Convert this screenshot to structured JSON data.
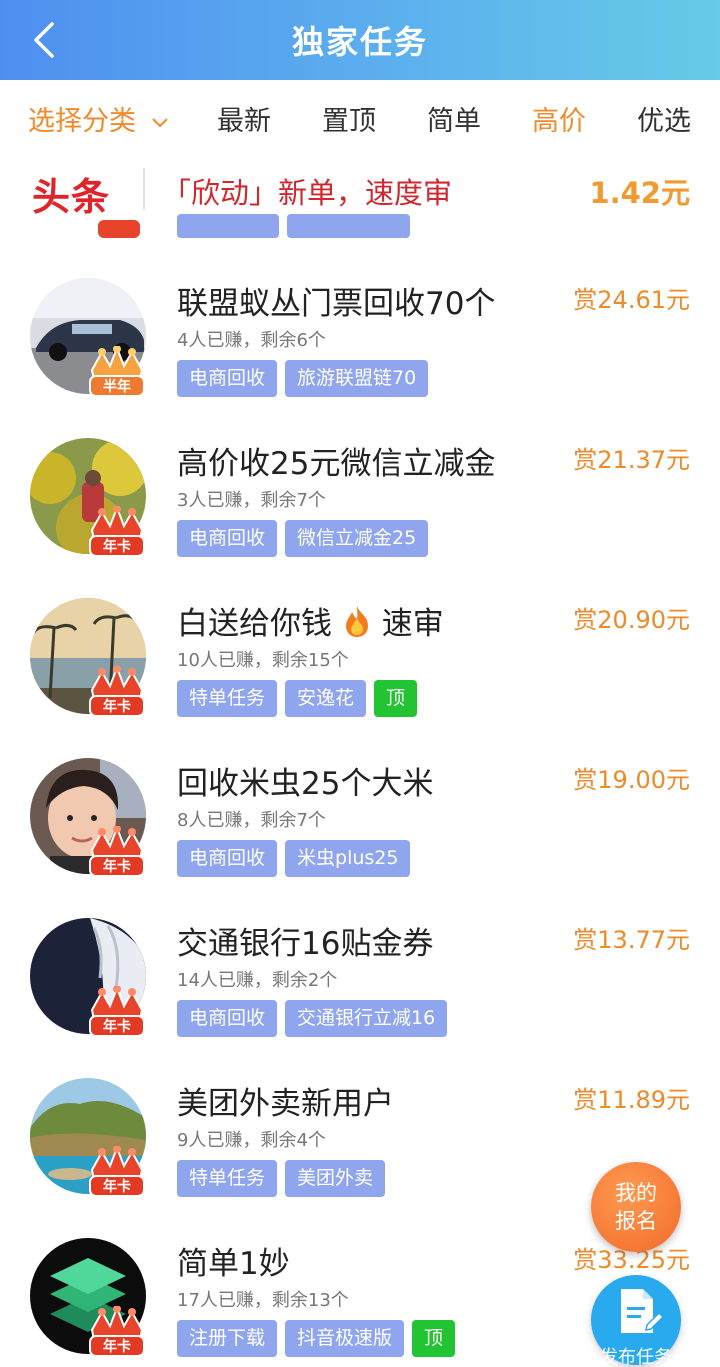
{
  "header": {
    "title": "独家任务"
  },
  "filters": {
    "category": "选择分类",
    "items": [
      "最新",
      "置顶",
      "简单",
      "高价",
      "优选"
    ]
  },
  "banner": {
    "brand": "头条",
    "text": "「欣动」新单，速度审",
    "price": "1.42元"
  },
  "badges": {
    "half_year": "半年",
    "year": "年卡"
  },
  "tasks": [
    {
      "title": "联盟蚁丛门票回收70个",
      "price": "赏24.61元",
      "meta": "4人已赚，剩余6个",
      "tags": [
        "电商回收",
        "旅游联盟链70"
      ],
      "badge": "半年"
    },
    {
      "title": "高价收25元微信立减金",
      "price": "赏21.37元",
      "meta": "3人已赚，剩余7个",
      "tags": [
        "电商回收",
        "微信立减金25"
      ],
      "badge": "年卡"
    },
    {
      "title": "白送给你钱",
      "title_suffix": "速审",
      "price": "赏20.90元",
      "meta": "10人已赚，剩余15个",
      "tags": [
        "特单任务",
        "安逸花"
      ],
      "top": "顶",
      "badge": "年卡"
    },
    {
      "title": "回收米虫25个大米",
      "price": "赏19.00元",
      "meta": "8人已赚，剩余7个",
      "tags": [
        "电商回收",
        "米虫plus25"
      ],
      "badge": "年卡"
    },
    {
      "title": "交通银行16贴金券",
      "price": "赏13.77元",
      "meta": "14人已赚，剩余2个",
      "tags": [
        "电商回收",
        "交通银行立减16"
      ],
      "badge": "年卡"
    },
    {
      "title": "美团外卖新用户",
      "price": "赏11.89元",
      "meta": "9人已赚，剩余4个",
      "tags": [
        "特单任务",
        "美团外卖"
      ],
      "badge": "年卡"
    },
    {
      "title": "简单1妙",
      "price": "赏33.25元",
      "meta": "17人已赚，剩余13个",
      "tags": [
        "注册下载",
        "抖音极速版"
      ],
      "top": "顶",
      "badge": "年卡"
    }
  ],
  "fab": {
    "my_signup_line1": "我的",
    "my_signup_line2": "报名",
    "publish": "发布任务"
  }
}
